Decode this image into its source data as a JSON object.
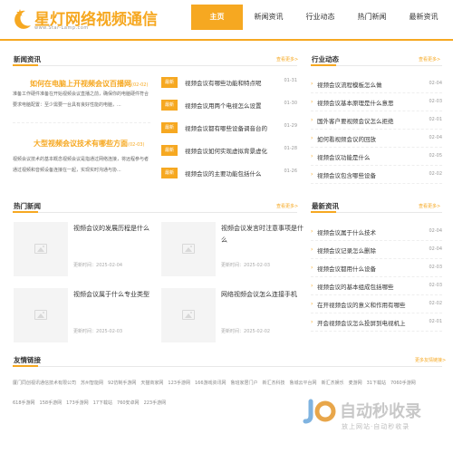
{
  "site": {
    "name": "星灯网络视频通信",
    "subtitle": "www.Star-Lamp.com",
    "accent_color": "#f6a821"
  },
  "nav": [
    "主页",
    "新闻资讯",
    "行业动态",
    "热门新闻",
    "最新资讯"
  ],
  "news": {
    "title": "新闻资讯",
    "more": "查看更多>",
    "headlines": [
      {
        "title": "如何在电脑上开视频会议百播网",
        "tag": "(02-02)",
        "summary": "准备工作硬件准备在开始视频会议直播之前，确保你的电脑硬件符合要求电脑配置：至少需要一台具有良好性能的电脑，..."
      },
      {
        "title": "大型视频会议技术有哪些方面",
        "tag": "(02-03)",
        "summary": "视频会议技术的基本概念视频会议是指通过网络连接，将远程参与者通过视频和音频设备连接在一起，实现实时沟通与协..."
      }
    ],
    "list": [
      {
        "badge": "最新",
        "text": "视频会议有哪些功能和特点呢",
        "date": "01-31"
      },
      {
        "badge": "最新",
        "text": "视频会议用两个电视怎么设置",
        "date": "01-30"
      },
      {
        "badge": "最新",
        "text": "视频会议都有哪些设备调音台的",
        "date": "01-29"
      },
      {
        "badge": "最新",
        "text": "视频会议如何实现虚拟背景虚化",
        "date": "01-28"
      },
      {
        "badge": "最新",
        "text": "视频会议的主要功能包括什么",
        "date": "01-26"
      }
    ]
  },
  "industry": {
    "title": "行业动态",
    "more": "查看更多>",
    "items": [
      {
        "text": "视频会议流程模板怎么做",
        "date": "02-04"
      },
      {
        "text": "视频会议基本原理是什么意思",
        "date": "02-03"
      },
      {
        "text": "国外客户要视频会议怎么拒绝",
        "date": "02-01"
      },
      {
        "text": "如何看视频会议的回放",
        "date": "02-04"
      },
      {
        "text": "视频会议功能是什么",
        "date": "02-05"
      },
      {
        "text": "视频会议包含哪些设备",
        "date": "02-02"
      }
    ]
  },
  "hot": {
    "title": "热门新闻",
    "more": "查看更多>",
    "date_prefix": "更新时间：",
    "cards": [
      {
        "title": "视频会议的发展历程是什么",
        "date": "2025-02-04"
      },
      {
        "title": "视频会议发言时注意事项是什么",
        "date": "2025-02-03"
      },
      {
        "title": "视频会议属于什么专业类型",
        "date": "2025-02-03"
      },
      {
        "title": "网络视频会议怎么连接手机",
        "date": "2025-02-02"
      }
    ]
  },
  "latest": {
    "title": "最新资讯",
    "more": "查看更多>",
    "items": [
      {
        "text": "视频会议属于什么技术",
        "date": "02-04"
      },
      {
        "text": "视频会议记录怎么删除",
        "date": "02-04"
      },
      {
        "text": "视频会议都用什么设备",
        "date": "02-03"
      },
      {
        "text": "视频会议的基本组成包括哪些",
        "date": "02-03"
      },
      {
        "text": "在开视频会议的意义和作用有哪些",
        "date": "02-02"
      },
      {
        "text": "开会视频会议怎么投屏到电视机上",
        "date": "02-01"
      }
    ]
  },
  "links": {
    "title": "友情链接",
    "more": "更多友情链接>",
    "items": [
      "厦门同创视讯通信技术有限公司",
      "苏州智能网",
      "92仿制手游网",
      "天猫商家网",
      "123手游网",
      "166游戏资讯网",
      "鲁班家居门户",
      "新汇杰科技",
      "鲁城云平台网",
      "新汇杰娱乐",
      "麦游网",
      "31下载站",
      "7060手游网",
      "618手游网",
      "158手游网",
      "173手游网",
      "17下载站",
      "760安卓网",
      "223手游网"
    ]
  },
  "watermark": {
    "text": "自动秒收录",
    "sub": "放上网站·自动秒收录"
  }
}
